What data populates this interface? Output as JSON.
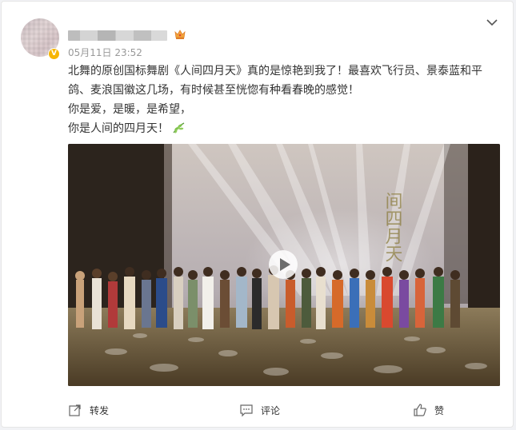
{
  "post": {
    "author": {
      "avatar": "blurred-avatar",
      "nickname": "",
      "verified_badge": "V",
      "badge_icon": "crown-icon"
    },
    "timestamp": "05月11日 23:52",
    "text_line1": "北舞的原创国标舞剧《人间四月天》真的是惊艳到我了！最喜欢飞行员、景泰蓝和平",
    "text_line2": "鸽、麦浪国徽这几场，有时候甚至恍惚有种看春晚的感觉！",
    "text_line3": "你是爱，是暖，是希望，",
    "text_line4": "你是人间的四月天！",
    "emoji_icon": "leaf-icon",
    "video_backdrop_text": "间四月天"
  },
  "actions": {
    "repost_label": "转发",
    "comment_label": "评论",
    "like_label": "赞"
  },
  "colors": {
    "accent": "#f7b500",
    "text": "#333333",
    "meta": "#999999",
    "stage_floor": "#6b5a3a"
  }
}
